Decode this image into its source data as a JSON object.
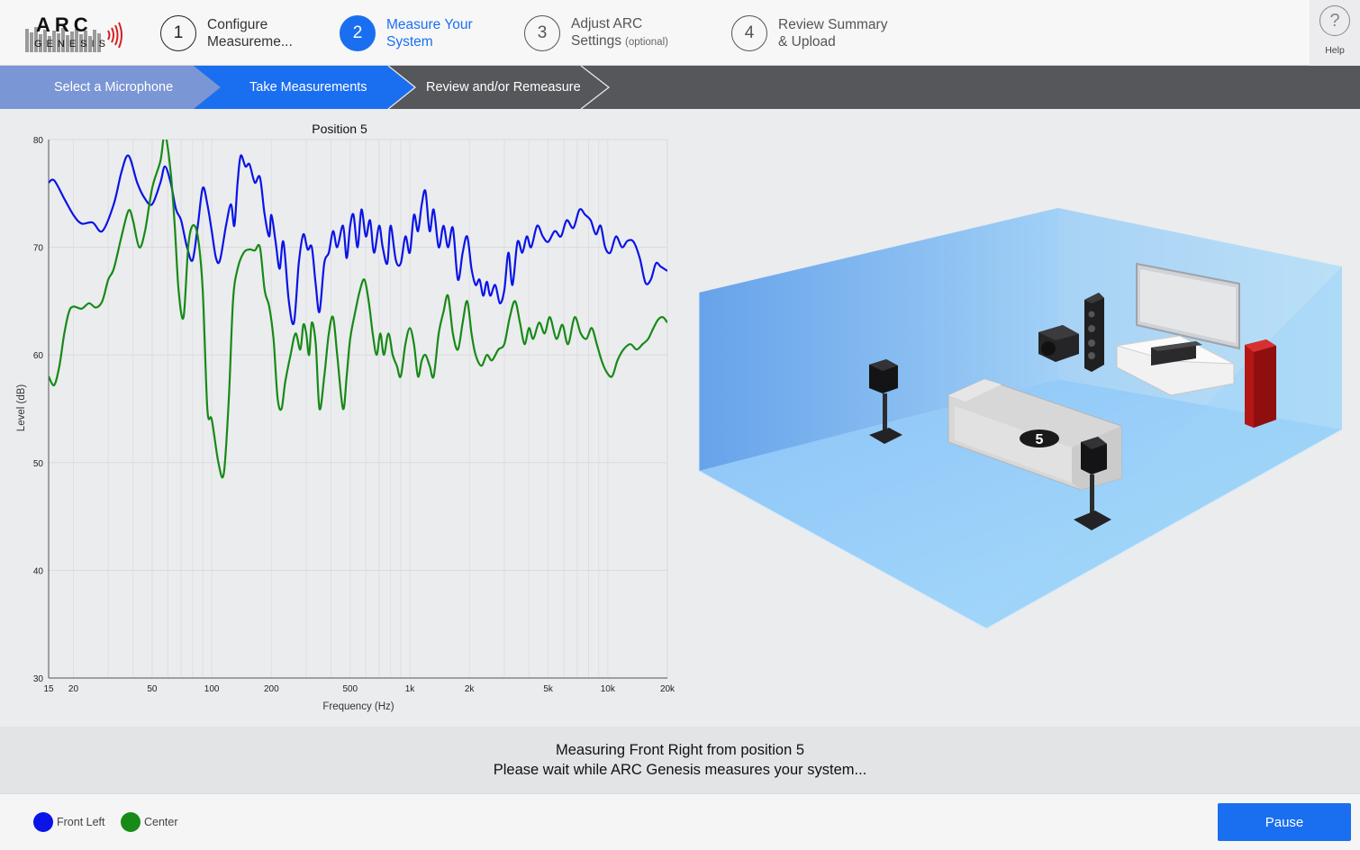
{
  "logo": {
    "text_top": "ARC",
    "text_bottom": "GENESIS"
  },
  "steps": [
    {
      "num": "1",
      "line1": "Configure",
      "line2": "Measureme...",
      "optional": ""
    },
    {
      "num": "2",
      "line1": "Measure Your",
      "line2": "System",
      "optional": ""
    },
    {
      "num": "3",
      "line1": "Adjust ARC",
      "line2": "Settings",
      "optional": "(optional)"
    },
    {
      "num": "4",
      "line1": "Review Summary",
      "line2": "& Upload",
      "optional": ""
    }
  ],
  "help": {
    "icon": "?",
    "label": "Help"
  },
  "subnav": {
    "items": [
      {
        "label": "Select a Microphone"
      },
      {
        "label": "Take Measurements"
      },
      {
        "label": "Review and/or Remeasure"
      }
    ]
  },
  "room": {
    "position_label": "5"
  },
  "status": {
    "line1": "Measuring Front Right from position 5",
    "line2": "Please wait while ARC Genesis measures your system..."
  },
  "legend": [
    {
      "name": "Front Left",
      "color": "#0a14e6"
    },
    {
      "name": "Center",
      "color": "#178a17"
    }
  ],
  "pause_label": "Pause",
  "colors": {
    "accent": "#1a6ff0",
    "front_left": "#0a14e6",
    "center": "#178a17"
  },
  "chart_data": {
    "type": "line",
    "title": "Position 5",
    "xlabel": "Frequency (Hz)",
    "ylabel": "Level (dB)",
    "xscale": "log",
    "xlim": [
      15,
      20000
    ],
    "ylim": [
      30,
      80
    ],
    "xticks": [
      {
        "value": 15,
        "label": "15"
      },
      {
        "value": 20,
        "label": "20"
      },
      {
        "value": 50,
        "label": "50"
      },
      {
        "value": 100,
        "label": "100"
      },
      {
        "value": 200,
        "label": "200"
      },
      {
        "value": 500,
        "label": "500"
      },
      {
        "value": 1000,
        "label": "1k"
      },
      {
        "value": 2000,
        "label": "2k"
      },
      {
        "value": 5000,
        "label": "5k"
      },
      {
        "value": 10000,
        "label": "10k"
      },
      {
        "value": 20000,
        "label": "20k"
      }
    ],
    "yticks": [
      30,
      40,
      50,
      60,
      70,
      80
    ],
    "grid": true,
    "series": [
      {
        "name": "Front Left",
        "color": "#0a14e6",
        "points": [
          [
            15,
            76
          ],
          [
            16,
            76.2
          ],
          [
            18,
            74.5
          ],
          [
            20,
            73
          ],
          [
            22,
            72.2
          ],
          [
            25,
            72.3
          ],
          [
            28,
            71.5
          ],
          [
            32,
            74
          ],
          [
            35,
            77
          ],
          [
            38,
            78.5
          ],
          [
            42,
            76
          ],
          [
            46,
            74.5
          ],
          [
            50,
            74
          ],
          [
            55,
            76
          ],
          [
            58,
            77.5
          ],
          [
            62,
            76
          ],
          [
            66,
            73.5
          ],
          [
            70,
            72.5
          ],
          [
            75,
            70
          ],
          [
            80,
            68.8
          ],
          [
            85,
            72
          ],
          [
            90,
            75.5
          ],
          [
            95,
            74
          ],
          [
            100,
            71.5
          ],
          [
            105,
            69
          ],
          [
            110,
            68.8
          ],
          [
            118,
            72
          ],
          [
            125,
            74
          ],
          [
            130,
            72
          ],
          [
            135,
            76
          ],
          [
            140,
            78.5
          ],
          [
            148,
            77.5
          ],
          [
            155,
            77.7
          ],
          [
            165,
            76
          ],
          [
            175,
            76.5
          ],
          [
            185,
            73
          ],
          [
            195,
            71
          ],
          [
            200,
            73
          ],
          [
            210,
            70.5
          ],
          [
            220,
            68
          ],
          [
            230,
            70.5
          ],
          [
            245,
            65
          ],
          [
            260,
            63
          ],
          [
            275,
            68.5
          ],
          [
            290,
            71.2
          ],
          [
            305,
            69.8
          ],
          [
            320,
            70
          ],
          [
            335,
            66.5
          ],
          [
            350,
            64
          ],
          [
            370,
            68.5
          ],
          [
            390,
            69.5
          ],
          [
            410,
            71.5
          ],
          [
            430,
            70
          ],
          [
            460,
            72
          ],
          [
            480,
            69
          ],
          [
            500,
            72
          ],
          [
            520,
            73
          ],
          [
            545,
            70
          ],
          [
            570,
            73.5
          ],
          [
            600,
            71
          ],
          [
            630,
            72.5
          ],
          [
            660,
            69.5
          ],
          [
            700,
            72
          ],
          [
            730,
            70
          ],
          [
            770,
            68.5
          ],
          [
            800,
            72
          ],
          [
            850,
            68.8
          ],
          [
            900,
            68.5
          ],
          [
            950,
            71
          ],
          [
            1000,
            69.5
          ],
          [
            1050,
            73
          ],
          [
            1100,
            71.5
          ],
          [
            1150,
            74
          ],
          [
            1200,
            75.2
          ],
          [
            1260,
            71.5
          ],
          [
            1320,
            73.5
          ],
          [
            1400,
            70
          ],
          [
            1480,
            72
          ],
          [
            1560,
            70
          ],
          [
            1650,
            71.8
          ],
          [
            1750,
            67
          ],
          [
            1850,
            69.5
          ],
          [
            1950,
            71
          ],
          [
            2050,
            68
          ],
          [
            2150,
            66.5
          ],
          [
            2250,
            67
          ],
          [
            2350,
            65.5
          ],
          [
            2450,
            66.8
          ],
          [
            2550,
            65.5
          ],
          [
            2700,
            66.5
          ],
          [
            2850,
            64.8
          ],
          [
            3000,
            66
          ],
          [
            3150,
            69.5
          ],
          [
            3300,
            66.5
          ],
          [
            3500,
            70.5
          ],
          [
            3700,
            69.5
          ],
          [
            3900,
            71
          ],
          [
            4100,
            70
          ],
          [
            4400,
            72
          ],
          [
            4700,
            71
          ],
          [
            5000,
            70.5
          ],
          [
            5400,
            71.5
          ],
          [
            5800,
            71
          ],
          [
            6200,
            72.5
          ],
          [
            6700,
            71.8
          ],
          [
            7200,
            73.5
          ],
          [
            7700,
            73
          ],
          [
            8200,
            72.5
          ],
          [
            8700,
            71.2
          ],
          [
            9200,
            72
          ],
          [
            9700,
            70
          ],
          [
            10300,
            69.5
          ],
          [
            11000,
            71
          ],
          [
            11800,
            70
          ],
          [
            12600,
            70.6
          ],
          [
            13500,
            70.5
          ],
          [
            14500,
            69
          ],
          [
            15500,
            66.7
          ],
          [
            16500,
            67
          ],
          [
            17500,
            68.5
          ],
          [
            18500,
            68.2
          ],
          [
            20000,
            67.8
          ]
        ]
      },
      {
        "name": "Center",
        "color": "#178a17",
        "points": [
          [
            15,
            58
          ],
          [
            16,
            57.2
          ],
          [
            17,
            59
          ],
          [
            18,
            62
          ],
          [
            19,
            64
          ],
          [
            20,
            64.5
          ],
          [
            22,
            64.3
          ],
          [
            24,
            64.8
          ],
          [
            26,
            64.4
          ],
          [
            28,
            65
          ],
          [
            30,
            67
          ],
          [
            32,
            68
          ],
          [
            35,
            71
          ],
          [
            38,
            73.4
          ],
          [
            40,
            72.5
          ],
          [
            43,
            70
          ],
          [
            46,
            71.5
          ],
          [
            50,
            75.5
          ],
          [
            55,
            78
          ],
          [
            58,
            80.5
          ],
          [
            62,
            77
          ],
          [
            65,
            72
          ],
          [
            68,
            66
          ],
          [
            72,
            63.5
          ],
          [
            76,
            70
          ],
          [
            80,
            72
          ],
          [
            85,
            71
          ],
          [
            90,
            66
          ],
          [
            95,
            55
          ],
          [
            100,
            54
          ],
          [
            108,
            50
          ],
          [
            115,
            49
          ],
          [
            122,
            56
          ],
          [
            128,
            65
          ],
          [
            135,
            68
          ],
          [
            145,
            69.5
          ],
          [
            155,
            69.8
          ],
          [
            165,
            69.7
          ],
          [
            175,
            70
          ],
          [
            185,
            66
          ],
          [
            195,
            64.5
          ],
          [
            205,
            61.5
          ],
          [
            215,
            56
          ],
          [
            225,
            55
          ],
          [
            235,
            57.5
          ],
          [
            250,
            60
          ],
          [
            265,
            62
          ],
          [
            280,
            60.5
          ],
          [
            290,
            62.8
          ],
          [
            300,
            62
          ],
          [
            310,
            60
          ],
          [
            320,
            63
          ],
          [
            335,
            61
          ],
          [
            350,
            55
          ],
          [
            370,
            58
          ],
          [
            390,
            62
          ],
          [
            410,
            63.5
          ],
          [
            430,
            60
          ],
          [
            460,
            55
          ],
          [
            480,
            58
          ],
          [
            500,
            61.5
          ],
          [
            530,
            64
          ],
          [
            560,
            66
          ],
          [
            590,
            67
          ],
          [
            620,
            65
          ],
          [
            650,
            62
          ],
          [
            680,
            60
          ],
          [
            710,
            62
          ],
          [
            740,
            60
          ],
          [
            780,
            62
          ],
          [
            820,
            60
          ],
          [
            860,
            59
          ],
          [
            900,
            58
          ],
          [
            950,
            61
          ],
          [
            1000,
            62.5
          ],
          [
            1050,
            61
          ],
          [
            1100,
            58
          ],
          [
            1150,
            59.5
          ],
          [
            1200,
            60
          ],
          [
            1260,
            59
          ],
          [
            1320,
            58
          ],
          [
            1400,
            62
          ],
          [
            1480,
            64
          ],
          [
            1560,
            65.5
          ],
          [
            1650,
            62
          ],
          [
            1750,
            60.5
          ],
          [
            1850,
            63
          ],
          [
            1950,
            65
          ],
          [
            2050,
            62
          ],
          [
            2150,
            60
          ],
          [
            2300,
            59
          ],
          [
            2450,
            60
          ],
          [
            2600,
            59.5
          ],
          [
            2800,
            60.5
          ],
          [
            3000,
            61
          ],
          [
            3200,
            63.5
          ],
          [
            3400,
            65
          ],
          [
            3600,
            63
          ],
          [
            3800,
            61
          ],
          [
            4000,
            62.5
          ],
          [
            4200,
            61.5
          ],
          [
            4500,
            63
          ],
          [
            4800,
            62
          ],
          [
            5100,
            63.5
          ],
          [
            5500,
            61.5
          ],
          [
            5900,
            62.8
          ],
          [
            6300,
            61
          ],
          [
            6800,
            63.5
          ],
          [
            7300,
            62
          ],
          [
            7800,
            61.5
          ],
          [
            8300,
            62.5
          ],
          [
            8800,
            61
          ],
          [
            9300,
            59.5
          ],
          [
            9800,
            58.5
          ],
          [
            10500,
            58
          ],
          [
            11200,
            59.5
          ],
          [
            12000,
            60.5
          ],
          [
            13000,
            61
          ],
          [
            14000,
            60.5
          ],
          [
            15000,
            61
          ],
          [
            16000,
            61.5
          ],
          [
            17000,
            62.5
          ],
          [
            18000,
            63.3
          ],
          [
            19000,
            63.5
          ],
          [
            20000,
            63
          ]
        ]
      }
    ]
  }
}
